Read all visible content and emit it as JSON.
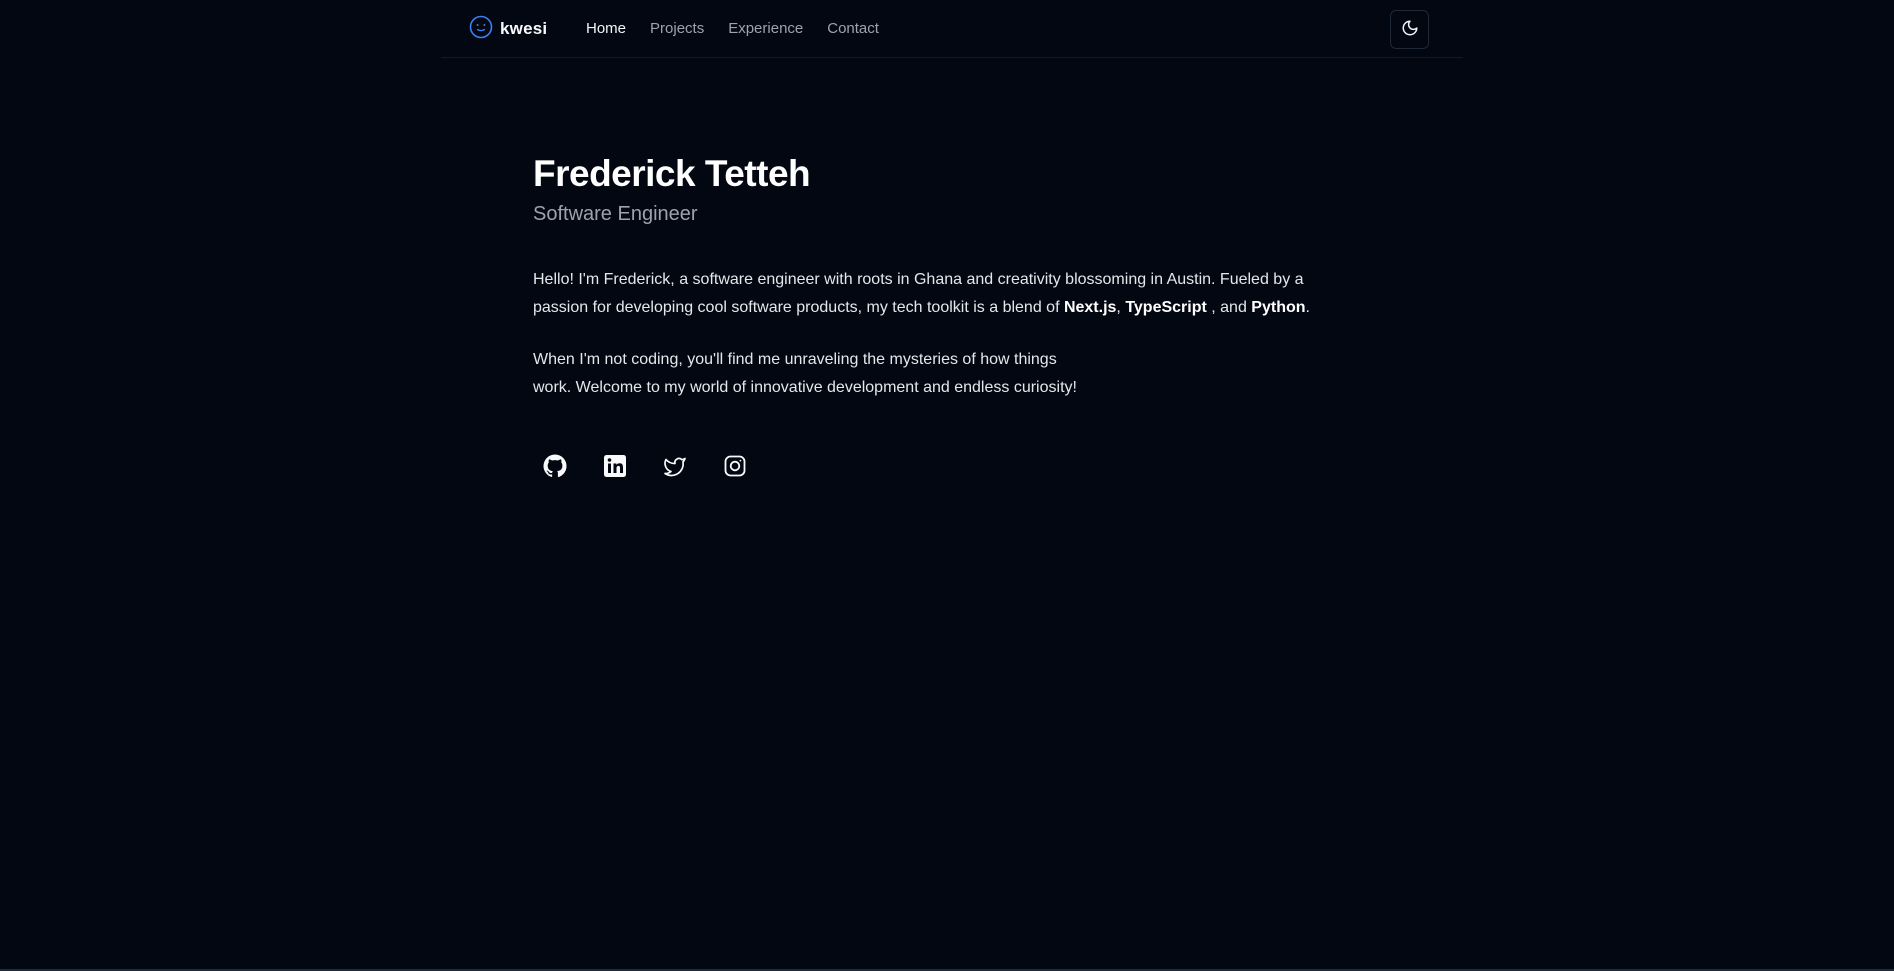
{
  "brand": {
    "name": "kwesi",
    "icon": "smiley-logo-icon"
  },
  "nav": {
    "items": [
      {
        "label": "Home",
        "active": true
      },
      {
        "label": "Projects",
        "active": false
      },
      {
        "label": "Experience",
        "active": false
      },
      {
        "label": "Contact",
        "active": false
      }
    ]
  },
  "theme_toggle": {
    "icon": "moon-icon"
  },
  "hero": {
    "name": "Frederick Tetteh",
    "role": "Software Engineer",
    "bio_intro": "Hello! I'm Frederick, a software engineer with roots in Ghana and creativity blossoming in Austin. Fueled by a passion for developing cool software products, my tech toolkit is a blend of ",
    "tech1": "Next.js",
    "sep1": ", ",
    "tech2": "TypeScript",
    "sep2": " , and ",
    "tech3": "Python",
    "bio_end": ".",
    "bio2": "When I'm not coding, you'll find me unraveling the mysteries of how things work. Welcome to my world of innovative development and endless curiosity!"
  },
  "socials": [
    {
      "icon": "github-icon"
    },
    {
      "icon": "linkedin-icon"
    },
    {
      "icon": "twitter-icon"
    },
    {
      "icon": "instagram-icon"
    }
  ],
  "colors": {
    "background": "#030712",
    "accent": "#3b82f6",
    "text": "#e5e7eb",
    "muted": "#9ca3af"
  }
}
